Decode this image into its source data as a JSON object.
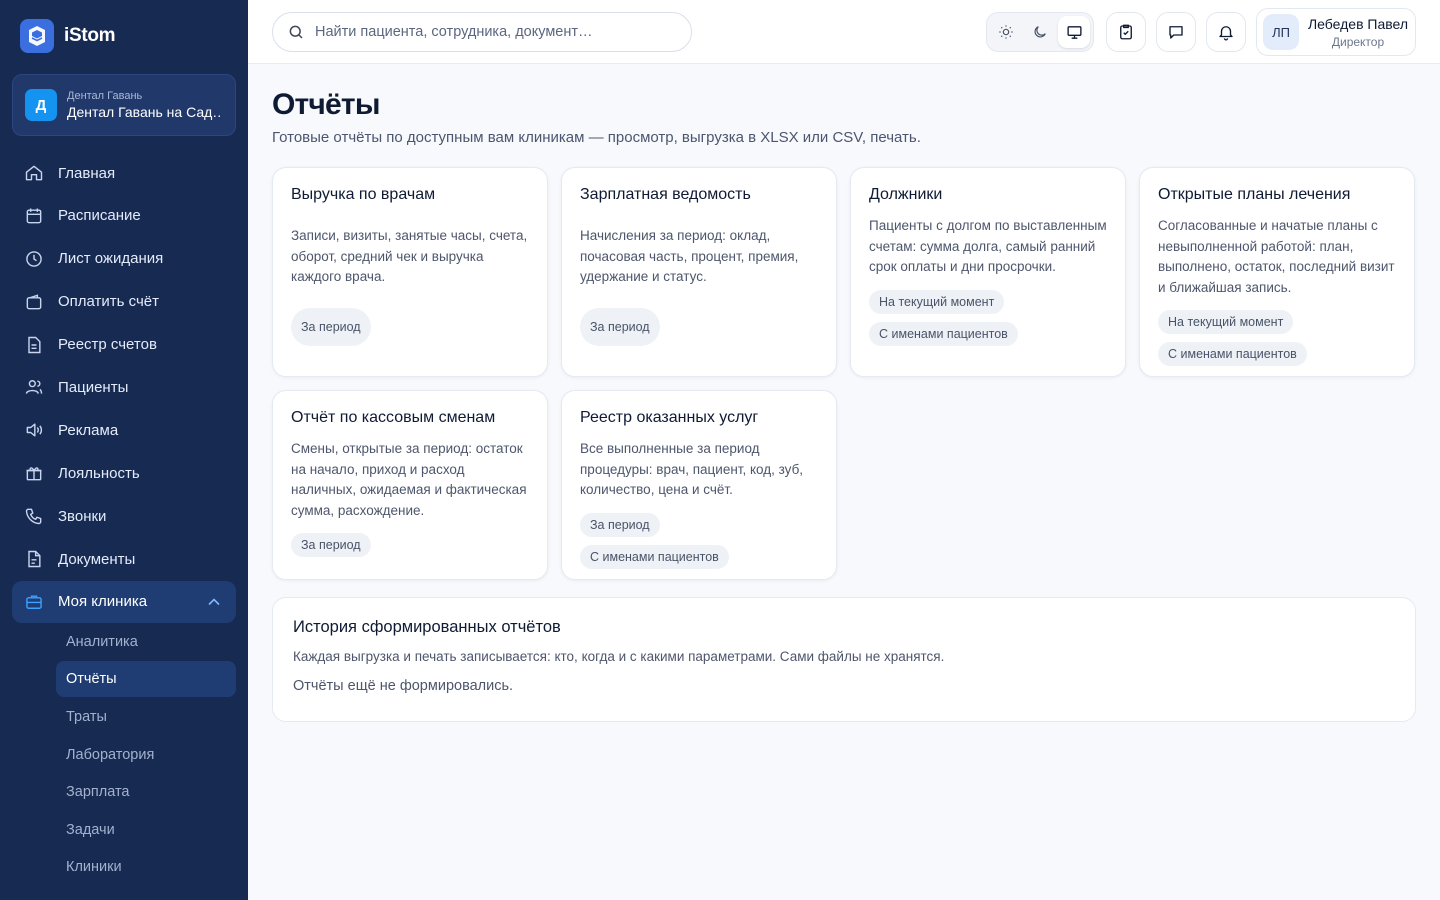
{
  "app": {
    "name": "iStom"
  },
  "clinic": {
    "avatar_letter": "Д",
    "org": "Дентал Гавань",
    "name": "Дентал Гавань на Садовой"
  },
  "nav": {
    "items": [
      {
        "label": "Главная",
        "icon": "home-icon"
      },
      {
        "label": "Расписание",
        "icon": "calendar-icon"
      },
      {
        "label": "Лист ожидания",
        "icon": "clock-icon"
      },
      {
        "label": "Оплатить счёт",
        "icon": "wallet-icon"
      },
      {
        "label": "Реестр счетов",
        "icon": "document-icon"
      },
      {
        "label": "Пациенты",
        "icon": "users-icon"
      },
      {
        "label": "Реклама",
        "icon": "megaphone-icon"
      },
      {
        "label": "Лояльность",
        "icon": "gift-icon"
      },
      {
        "label": "Звонки",
        "icon": "phone-icon"
      },
      {
        "label": "Документы",
        "icon": "file-icon"
      }
    ],
    "active_section": {
      "label": "Моя клиника",
      "icon": "briefcase-icon"
    },
    "sub_items": [
      "Аналитика",
      "Отчёты",
      "Траты",
      "Лаборатория",
      "Зарплата",
      "Задачи",
      "Клиники"
    ],
    "active_sub": "Отчёты"
  },
  "search": {
    "placeholder": "Найти пациента, сотрудника, документ…"
  },
  "user": {
    "initials": "ЛП",
    "name": "Лебедев Павел",
    "role": "Директор"
  },
  "page": {
    "title": "Отчёты",
    "subtitle": "Готовые отчёты по доступным вам клиникам — просмотр, выгрузка в XLSX или CSV, печать."
  },
  "reports": [
    {
      "title": "Выручка по врачам",
      "desc": "Записи, визиты, занятые часы, счета, оборот, средний чек и выручка каждого врача.",
      "tags": [
        "За период"
      ]
    },
    {
      "title": "Зарплатная ведомость",
      "desc": "Начисления за период: оклад, почасовая часть, процент, премия, удержание и статус.",
      "tags": [
        "За период"
      ]
    },
    {
      "title": "Должники",
      "desc": "Пациенты с долгом по выставленным счетам: сумма долга, самый ранний срок оплаты и дни просрочки.",
      "tags": [
        "На текущий момент",
        "С именами пациентов"
      ]
    },
    {
      "title": "Открытые планы лечения",
      "desc": "Согласованные и начатые планы с невыполненной работой: план, выполнено, остаток, последний визит и ближайшая запись.",
      "tags": [
        "На текущий момент",
        "С именами пациентов"
      ]
    },
    {
      "title": "Отчёт по кассовым сменам",
      "desc": "Смены, открытые за период: остаток на начало, приход и расход наличных, ожидаемая и фактическая сумма, расхождение.",
      "tags": [
        "За период"
      ]
    },
    {
      "title": "Реестр оказанных услуг",
      "desc": "Все выполненные за период процедуры: врач, пациент, код, зуб, количество, цена и счёт.",
      "tags": [
        "За период",
        "С именами пациентов"
      ]
    }
  ],
  "history": {
    "title": "История сформированных отчётов",
    "desc": "Каждая выгрузка и печать записывается: кто, когда и с какими параметрами. Сами файлы не хранятся.",
    "empty": "Отчёты ещё не формировались."
  },
  "colors": {
    "sidebar_bg": "#172a52",
    "active_bg": "#1f3d72",
    "accent": "#3b6fe0",
    "clinic_badge": "#1593f0",
    "page_bg": "#f7f9fc"
  }
}
